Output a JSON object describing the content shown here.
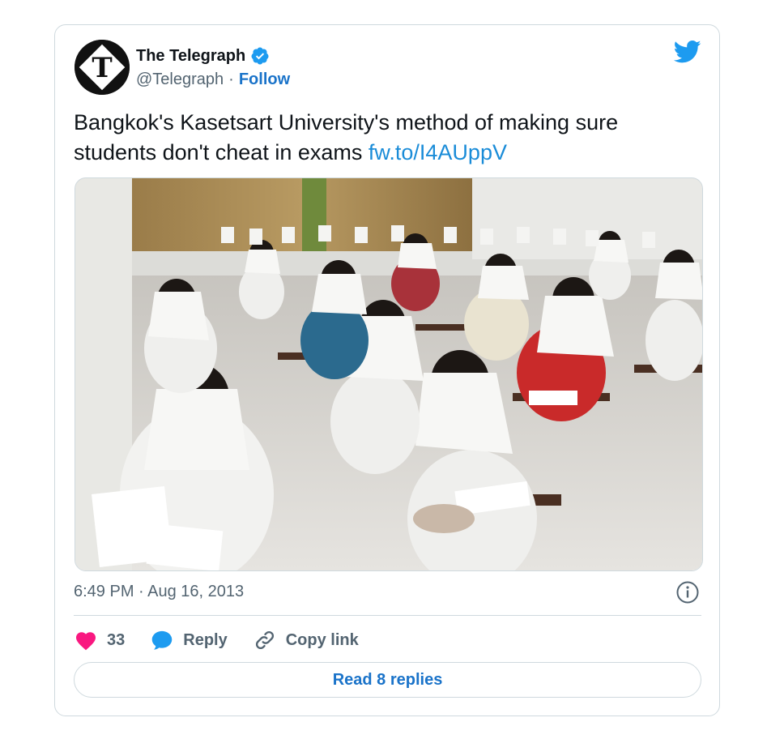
{
  "author": {
    "name": "The Telegraph",
    "handle": "@Telegraph",
    "separator": "·",
    "follow_label": "Follow",
    "avatar_icon": "telegraph-logo-icon",
    "verified_icon": "verified-badge-icon"
  },
  "tweet": {
    "text": "Bangkok's Kasetsart University's method of making sure students don't cheat in exams ",
    "link": "fw.to/I4AUppV",
    "timestamp": "6:49 PM · Aug 16, 2013"
  },
  "media": {
    "kind": "photo"
  },
  "actions": {
    "like_count": "33",
    "reply_label": "Reply",
    "copy_link_label": "Copy link",
    "read_replies_label": "Read 8 replies"
  },
  "colors": {
    "accent": "#1d9bf0",
    "like": "#f91880",
    "muted": "#536471",
    "border": "#cfd9de"
  }
}
